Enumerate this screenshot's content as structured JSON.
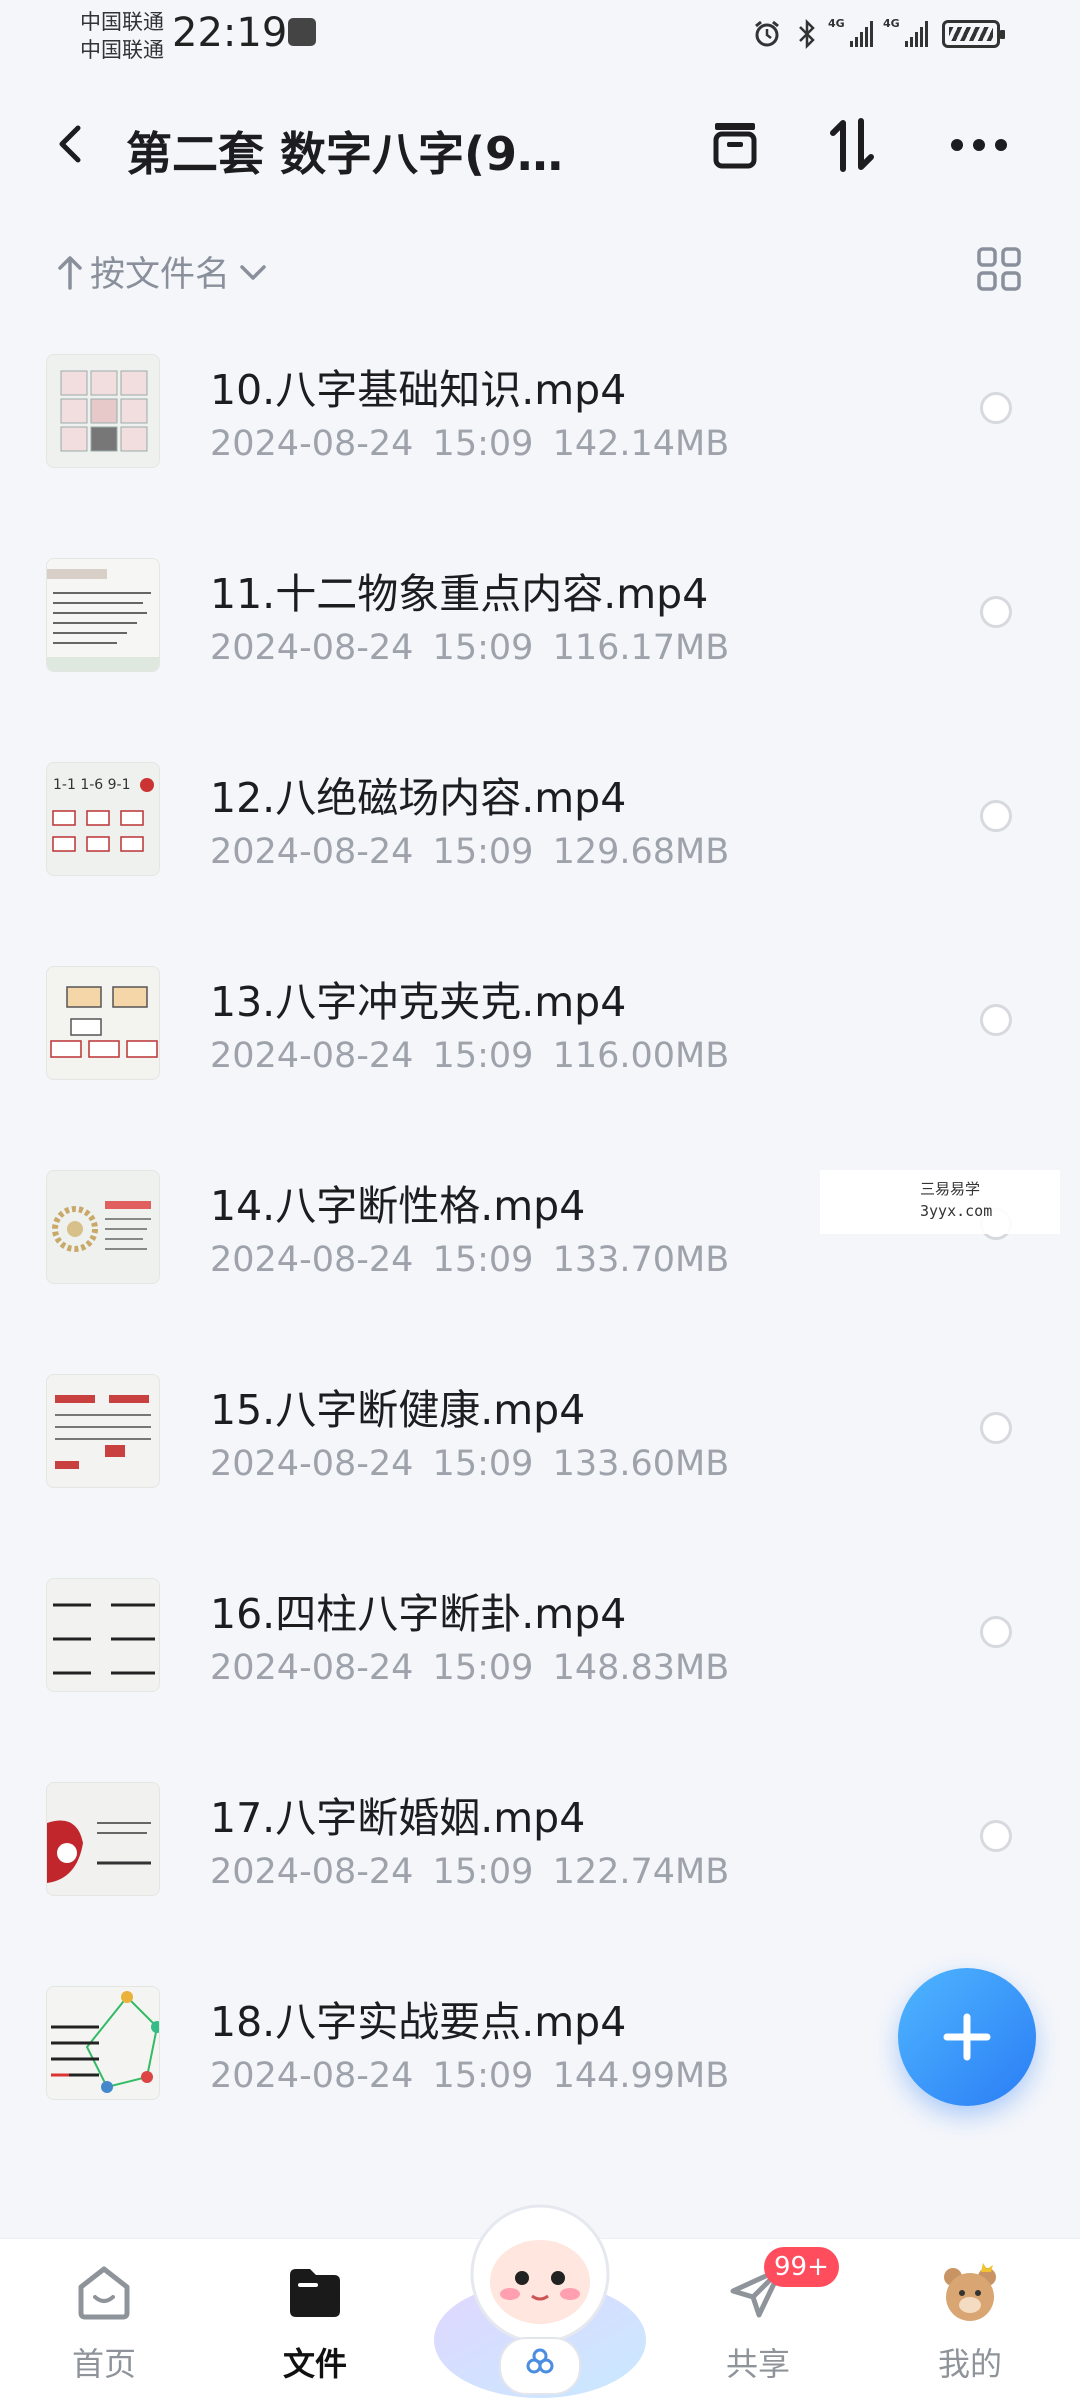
{
  "status_bar": {
    "carrier_1": "中国联通",
    "carrier_2": "中国联通",
    "time": "22:19",
    "network_1": "4G",
    "network_2": "4G"
  },
  "header": {
    "title": "第二套 数字八字(9…",
    "icons": [
      "back-icon",
      "archive-icon",
      "sort-swap-icon",
      "more-icon"
    ]
  },
  "sort": {
    "label": "按文件名"
  },
  "files": [
    {
      "name": "10.八字基础知识.mp4",
      "date": "2024-08-24",
      "time": "15:09",
      "size": "142.14MB"
    },
    {
      "name": "11.十二物象重点内容.mp4",
      "date": "2024-08-24",
      "time": "15:09",
      "size": "116.17MB"
    },
    {
      "name": "12.八绝磁场内容.mp4",
      "date": "2024-08-24",
      "time": "15:09",
      "size": "129.68MB"
    },
    {
      "name": "13.八字冲克夹克.mp4",
      "date": "2024-08-24",
      "time": "15:09",
      "size": "116.00MB"
    },
    {
      "name": "14.八字断性格.mp4",
      "date": "2024-08-24",
      "time": "15:09",
      "size": "133.70MB"
    },
    {
      "name": "15.八字断健康.mp4",
      "date": "2024-08-24",
      "time": "15:09",
      "size": "133.60MB"
    },
    {
      "name": "16.四柱八字断卦.mp4",
      "date": "2024-08-24",
      "time": "15:09",
      "size": "148.83MB"
    },
    {
      "name": "17.八字断婚姻.mp4",
      "date": "2024-08-24",
      "time": "15:09",
      "size": "122.74MB"
    },
    {
      "name": "18.八字实战要点.mp4",
      "date": "2024-08-24",
      "time": "15:09",
      "size": "144.99MB"
    }
  ],
  "watermark": {
    "line1": "三易易学",
    "line2": "3yyx.com"
  },
  "nav": {
    "home": "首页",
    "files": "文件",
    "share": "共享",
    "share_badge": "99+",
    "mine": "我的"
  },
  "colors": {
    "accent": "#2a7df5",
    "badge": "#ff4d5e",
    "meta_text": "#9ea3ab"
  }
}
